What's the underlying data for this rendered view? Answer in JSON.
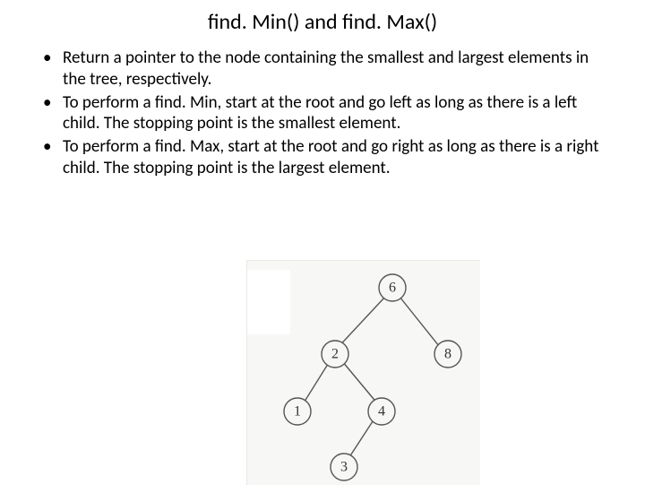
{
  "title": "find. Min() and find. Max()",
  "bullets": [
    "Return a pointer to the node containing the smallest and largest elements in the tree, respectively.",
    "To perform a find. Min, start at the root and go left as long as there is a left child. The stopping point is the smallest element.",
    "To perform a find. Max, start at the root and go right as long as there is a right child. The stopping point is the largest element."
  ],
  "tree": {
    "nodes": {
      "n6": "6",
      "n2": "2",
      "n8": "8",
      "n1": "1",
      "n4": "4",
      "n3": "3"
    }
  }
}
